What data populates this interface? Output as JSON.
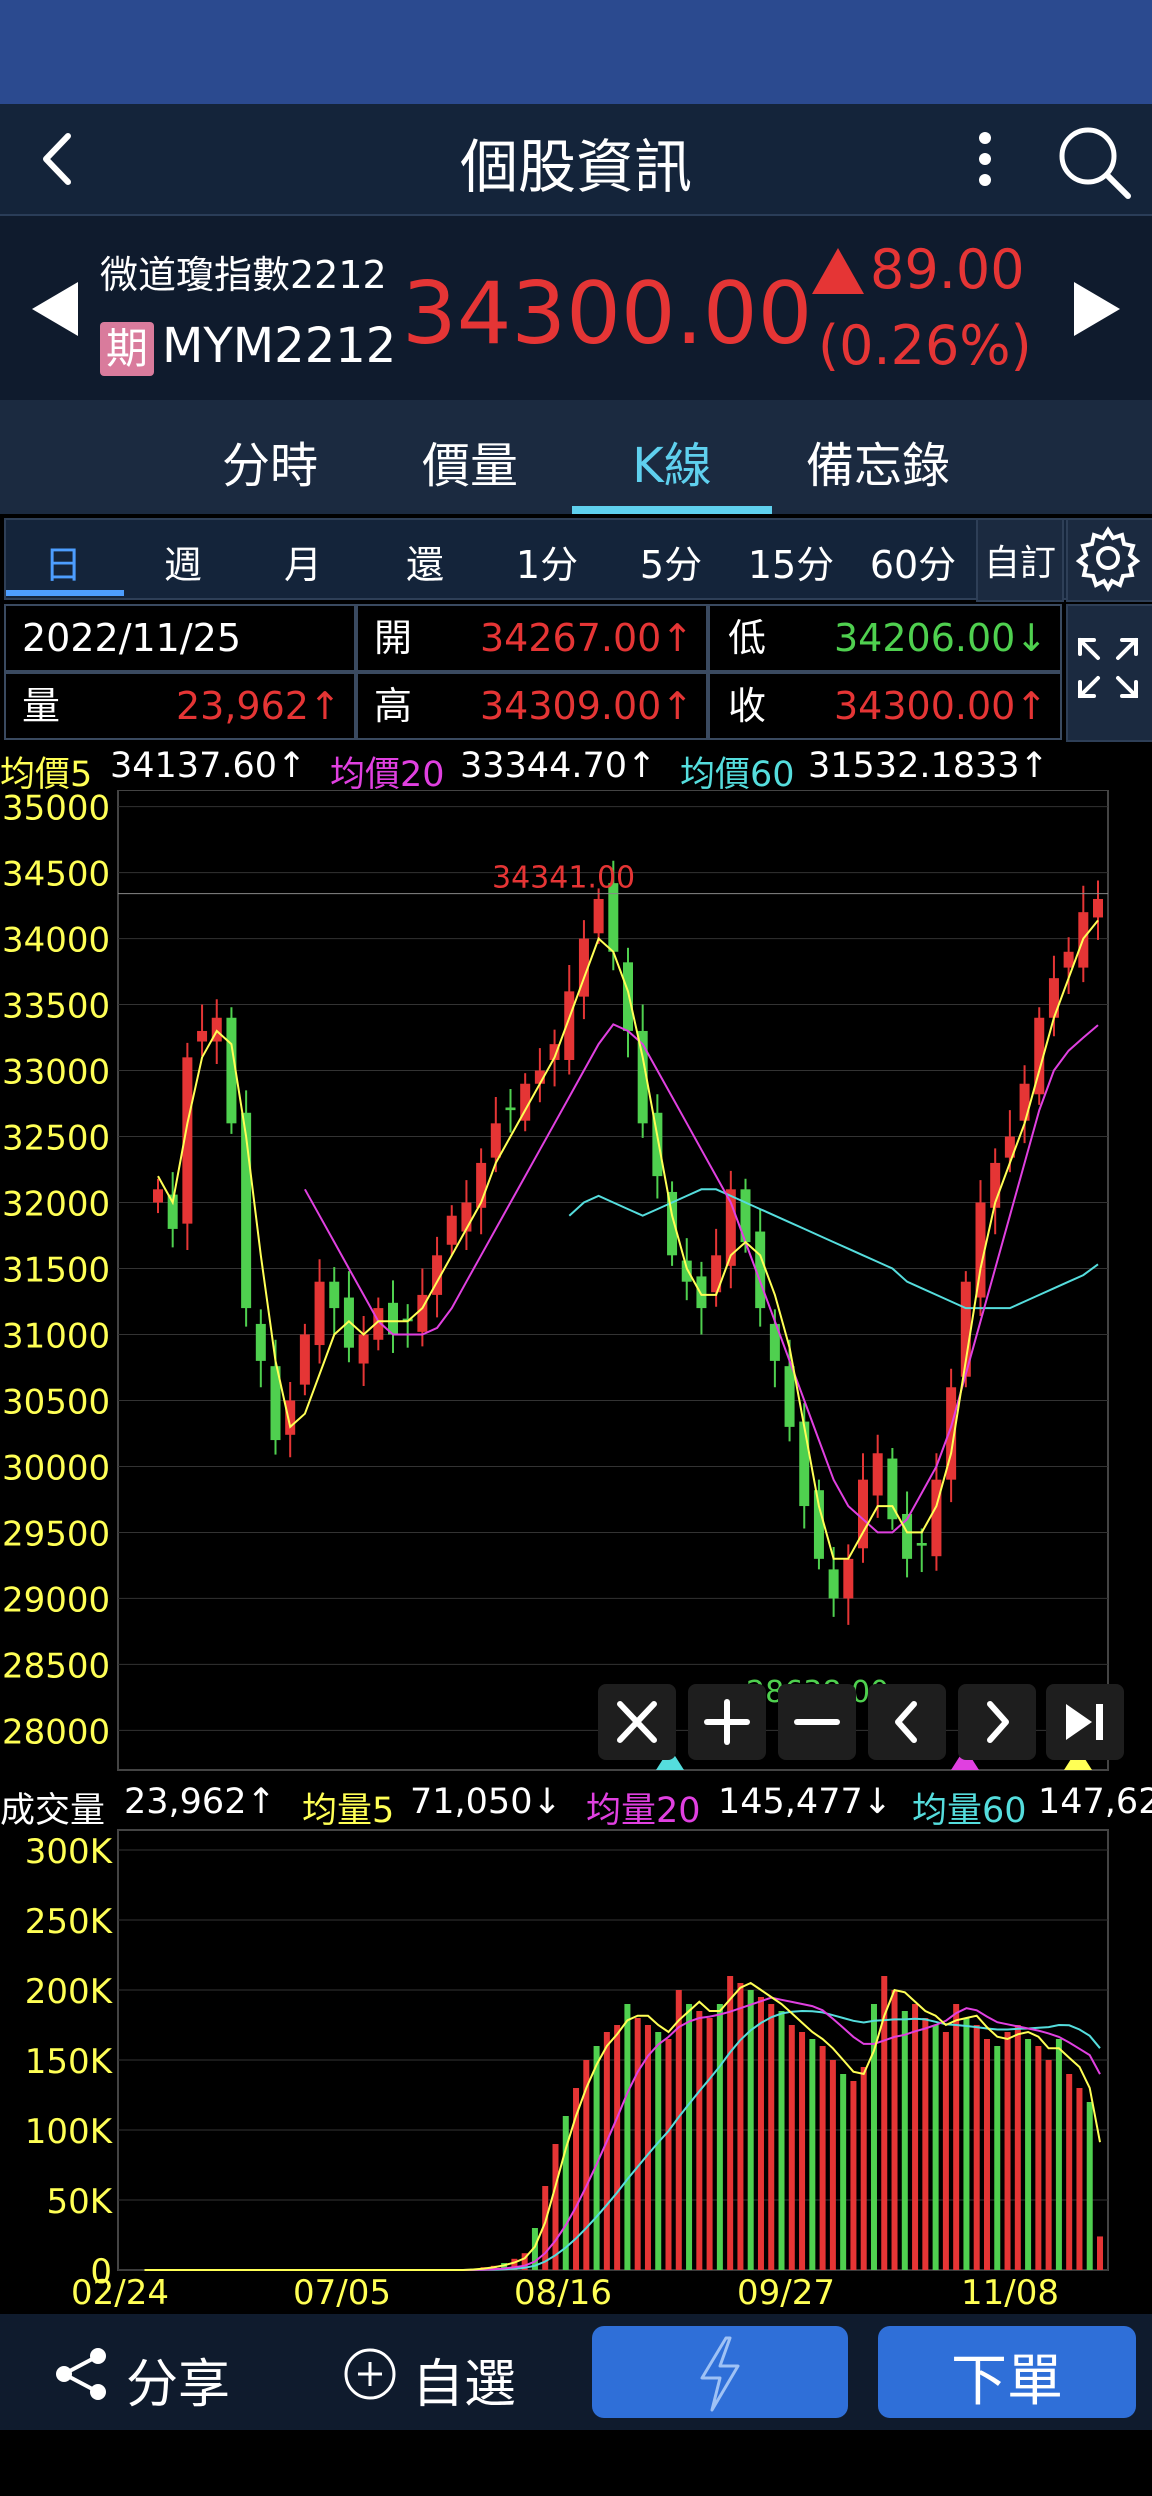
{
  "header": {
    "title": "個股資訊"
  },
  "quote": {
    "name": "微道瓊指數2212",
    "badge": "期",
    "code": "MYM2212",
    "price": "34300.00",
    "change": "89.00",
    "change_pct": "(0.26%)",
    "up_color": "#e53535"
  },
  "tabs": [
    {
      "label": "分時",
      "active": false
    },
    {
      "label": "價量",
      "active": false
    },
    {
      "label": "K線",
      "active": true
    },
    {
      "label": "備忘錄",
      "active": false
    }
  ],
  "periods": [
    {
      "label": "日",
      "active": true
    },
    {
      "label": "週",
      "active": false
    },
    {
      "label": "月",
      "active": false
    },
    {
      "label": "還",
      "active": false
    },
    {
      "label": "1分",
      "active": false
    },
    {
      "label": "5分",
      "active": false
    },
    {
      "label": "15分",
      "active": false
    },
    {
      "label": "60分",
      "active": false
    }
  ],
  "custom_label": "自訂",
  "info": {
    "date": "2022/11/25",
    "open_label": "開",
    "open": "34267.00↑",
    "low_label": "低",
    "low": "34206.00↓",
    "vol_label": "量",
    "vol": "23,962↑",
    "high_label": "高",
    "high": "34309.00↑",
    "close_label": "收",
    "close": "34300.00↑"
  },
  "ma_legend": {
    "ma5_label": "均價5",
    "ma5": "34137.60↑",
    "ma20_label": "均價20",
    "ma20": "33344.70↑",
    "ma60_label": "均價60",
    "ma60": "31532.1833↑"
  },
  "vol_legend": {
    "vol_label": "成交量",
    "vol": "23,962↑",
    "v5_label": "均量5",
    "v5": "71,050↓",
    "v20_label": "均量20",
    "v20": "145,477↓",
    "v60_label": "均量60",
    "v60": "147,62"
  },
  "chart_data": [
    {
      "type": "candlestick",
      "y_ticks": [
        "35000",
        "34500",
        "34000",
        "33500",
        "33000",
        "32500",
        "32000",
        "31500",
        "31000",
        "30500",
        "30000",
        "29500",
        "29000",
        "28500",
        "28000"
      ],
      "ylim": [
        27700,
        35050
      ],
      "high_annotation": "34341.00",
      "low_annotation": "28638.00",
      "x_ticks": [
        "02/24",
        "07/05",
        "08/16",
        "09/27",
        "11/08"
      ],
      "series_colors": {
        "ma5": "#ffff55",
        "ma20": "#e040e0",
        "ma60": "#55dddd",
        "up": "#e53535",
        "down": "#4fd04f"
      },
      "close": [
        32100,
        31800,
        33100,
        33300,
        33400,
        32600,
        31200,
        30800,
        30200,
        30500,
        31000,
        31400,
        31200,
        30900,
        31000,
        31200,
        31000,
        31100,
        31300,
        31600,
        31900,
        32000,
        32300,
        32600,
        32700,
        32900,
        33000,
        33200,
        33600,
        34000,
        34300,
        33900,
        33300,
        32600,
        32200,
        31600,
        31400,
        31200,
        31600,
        32100,
        31700,
        31200,
        30800,
        30300,
        29700,
        29300,
        29000,
        29300,
        29900,
        30100,
        29600,
        29300,
        29400,
        29900,
        30600,
        31400,
        32000,
        32300,
        32500,
        32900,
        33400,
        33700,
        33900,
        34200,
        34300
      ],
      "ma5": [
        32200,
        32000,
        32600,
        33100,
        33300,
        33200,
        32500,
        31600,
        30800,
        30300,
        30400,
        30700,
        31000,
        31100,
        31000,
        31100,
        31100,
        31100,
        31200,
        31400,
        31600,
        31800,
        32000,
        32300,
        32500,
        32700,
        32900,
        33100,
        33400,
        33700,
        34000,
        33900,
        33600,
        33100,
        32500,
        31900,
        31500,
        31300,
        31300,
        31600,
        31700,
        31600,
        31300,
        30900,
        30300,
        29700,
        29300,
        29300,
        29500,
        29700,
        29700,
        29500,
        29500,
        29700,
        30100,
        30800,
        31500,
        32000,
        32300,
        32600,
        33000,
        33400,
        33700,
        34000,
        34137.6
      ],
      "ma20": [
        null,
        null,
        null,
        null,
        null,
        null,
        null,
        null,
        null,
        null,
        32100,
        31900,
        31700,
        31500,
        31300,
        31100,
        31000,
        31000,
        31000,
        31050,
        31200,
        31400,
        31600,
        31800,
        32000,
        32200,
        32400,
        32600,
        32800,
        33000,
        33200,
        33350,
        33300,
        33200,
        33000,
        32800,
        32600,
        32400,
        32200,
        32000,
        31700,
        31400,
        31100,
        30800,
        30500,
        30200,
        29900,
        29700,
        29600,
        29500,
        29500,
        29600,
        29800,
        30000,
        30300,
        30700,
        31100,
        31500,
        31900,
        32300,
        32700,
        33000,
        33150,
        33250,
        33344.7
      ],
      "ma60": [
        null,
        null,
        null,
        null,
        null,
        null,
        null,
        null,
        null,
        null,
        null,
        null,
        null,
        null,
        null,
        null,
        null,
        null,
        null,
        null,
        null,
        null,
        null,
        null,
        null,
        null,
        null,
        null,
        31900,
        32000,
        32050,
        32000,
        31950,
        31900,
        31950,
        32000,
        32050,
        32100,
        32100,
        32050,
        32000,
        31950,
        31900,
        31850,
        31800,
        31750,
        31700,
        31650,
        31600,
        31550,
        31500,
        31400,
        31350,
        31300,
        31250,
        31200,
        31200,
        31200,
        31200,
        31250,
        31300,
        31350,
        31400,
        31450,
        31532.18
      ]
    },
    {
      "type": "bar",
      "y_ticks": [
        "300K",
        "250K",
        "200K",
        "150K",
        "100K",
        "50K",
        "0"
      ],
      "ylim": [
        0,
        300000
      ],
      "volumes_k": [
        0,
        0,
        0,
        0,
        0,
        0,
        0,
        0,
        0,
        0,
        0,
        0,
        0,
        0,
        0,
        0,
        0,
        0,
        0,
        0,
        0,
        0,
        0,
        0,
        0,
        0,
        0,
        0,
        0,
        0,
        0,
        0,
        0,
        0,
        1,
        2,
        3,
        5,
        8,
        12,
        30,
        60,
        90,
        110,
        130,
        150,
        160,
        170,
        175,
        190,
        180,
        175,
        170,
        165,
        200,
        190,
        185,
        180,
        190,
        210,
        205,
        200,
        195,
        190,
        185,
        175,
        170,
        165,
        160,
        150,
        140,
        135,
        145,
        190,
        210,
        200,
        185,
        190,
        180,
        175,
        170,
        190,
        180,
        175,
        165,
        160,
        170,
        175,
        165,
        160,
        150,
        165,
        140,
        130,
        120,
        23.962
      ]
    }
  ]
}
